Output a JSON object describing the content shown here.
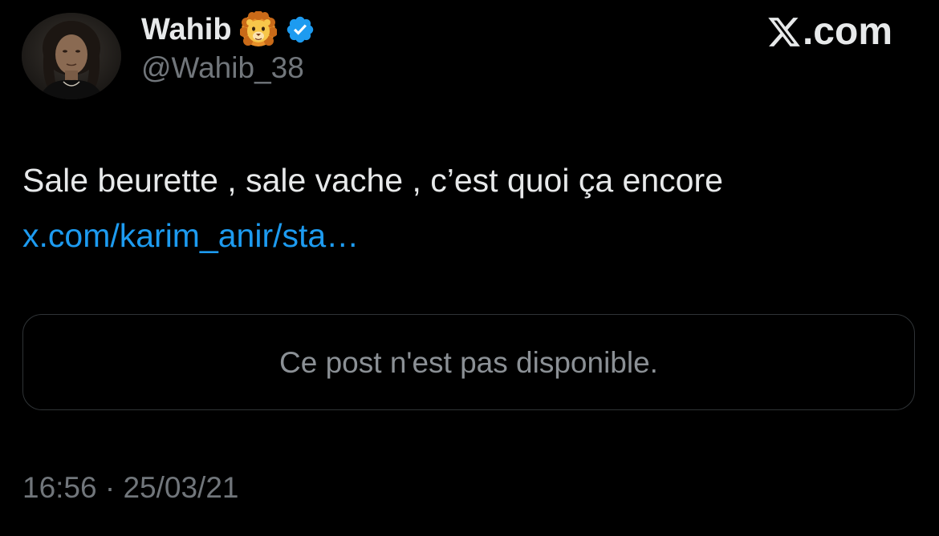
{
  "author": {
    "display_name": "Wahib",
    "name_emoji": "lion-face-icon",
    "verified_badge": "verified-badge-icon",
    "handle": "@Wahib_38",
    "avatar": "profile-photo"
  },
  "brand": {
    "logo": "x-logo-icon",
    "suffix": ".com"
  },
  "post": {
    "text": "Sale beurette , sale vache , c’est quoi ça encore",
    "link": "x.com/karim_anir/sta…"
  },
  "quoted_post": {
    "unavailable_text": "Ce post n'est pas disponible."
  },
  "meta": {
    "timestamp": "16:56 · 25/03/21"
  },
  "colors": {
    "background": "#000000",
    "text_primary": "#e7e9ea",
    "text_secondary": "#71767b",
    "link": "#1d9bf0",
    "verified": "#1d9bf0",
    "card_border": "#2f3336"
  }
}
